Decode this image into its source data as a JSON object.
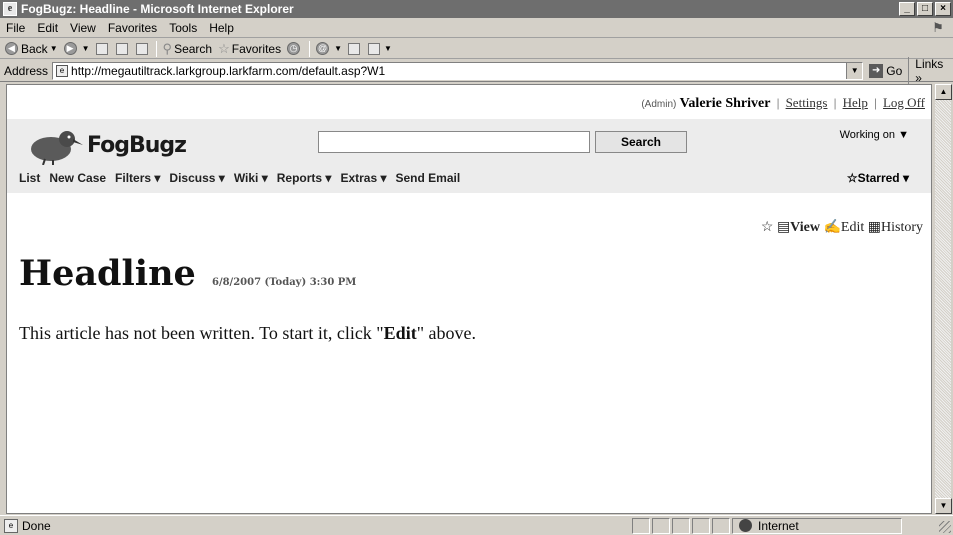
{
  "window": {
    "title": "FogBugz: Headline - Microsoft Internet Explorer",
    "app_icon": "ie-page-icon",
    "minimize": "_",
    "maximize": "□",
    "close": "×"
  },
  "menu": {
    "items": [
      "File",
      "Edit",
      "View",
      "Favorites",
      "Tools",
      "Help"
    ],
    "throbber_icon": "windows-flag-icon"
  },
  "toolbar": {
    "back_label": "Back",
    "search_label": "Search",
    "favorites_label": "Favorites"
  },
  "address": {
    "label": "Address",
    "url": "http://megautiltrack.larkgroup.larkfarm.com/default.asp?W1",
    "go_label": "Go",
    "links_label": "Links",
    "links_chevron": "»"
  },
  "fogbugz": {
    "user": {
      "role": "(Admin)",
      "name": "Valerie Shriver",
      "settings": "Settings",
      "help": "Help",
      "logoff": "Log Off"
    },
    "logo_text": "FogBugz",
    "search_button": "Search",
    "search_value": "",
    "working_on": "Working on ▼",
    "nav": [
      "List",
      "New Case",
      "Filters ▾",
      "Discuss ▾",
      "Wiki ▾",
      "Reports ▾",
      "Extras ▾",
      "Send Email"
    ],
    "starred": "☆Starred ▾"
  },
  "article": {
    "tools": {
      "star": "☆",
      "view_icon": "▤",
      "view": "View",
      "edit_icon": "✍",
      "edit": "Edit",
      "history_icon": "▦",
      "history": "History"
    },
    "title": "Headline",
    "timestamp": "6/8/2007 (Today) 3:30 PM",
    "body_before": "This article has not been written.  To start it, click \"",
    "body_bold": "Edit",
    "body_after": "\" above."
  },
  "status": {
    "text": "Done",
    "zone": "Internet"
  },
  "colors": {
    "titlebar": "#6e6e6e",
    "chrome": "#d4d0c8",
    "header_band": "#ececec"
  }
}
